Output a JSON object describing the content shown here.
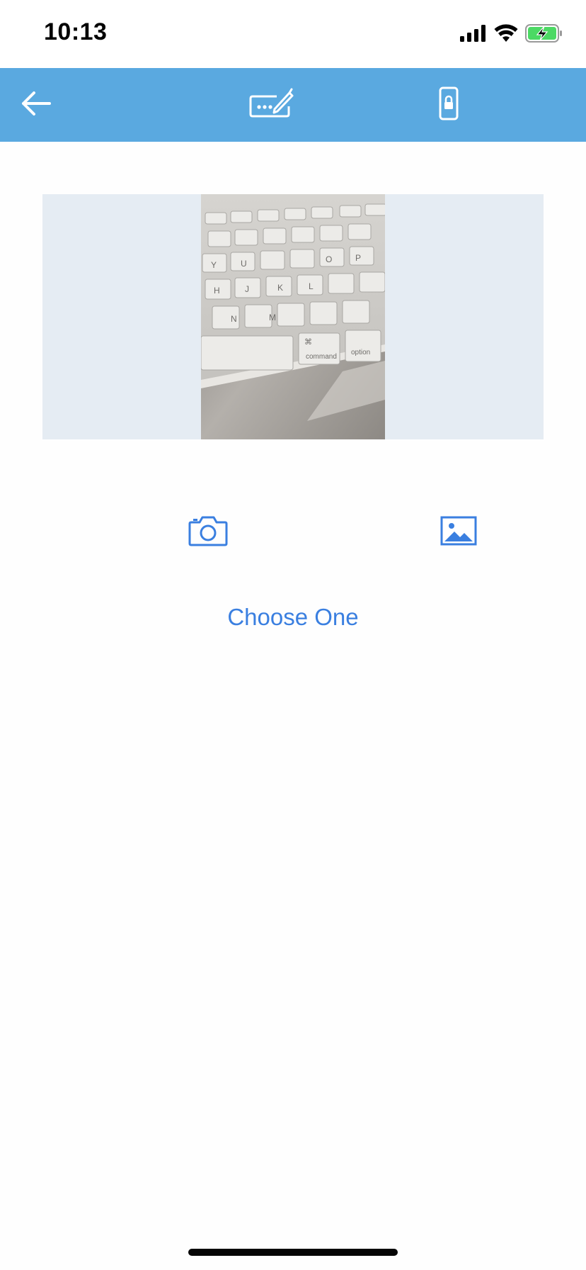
{
  "status_bar": {
    "time": "10:13",
    "icons": [
      "cellular-signal-icon",
      "wifi-icon",
      "battery-charging-icon"
    ]
  },
  "nav_bar": {
    "background_color": "#5aa9e0",
    "buttons": [
      {
        "icon": "back-arrow-icon"
      },
      {
        "icon": "signature-pad-icon"
      },
      {
        "icon": "phone-lock-icon"
      }
    ]
  },
  "preview": {
    "background_color": "#e5ecf3",
    "photo_subject": "keyboard-photo",
    "keyboard_keys": [
      "Y",
      "U",
      "H",
      "J",
      "K",
      "L",
      "N",
      "M",
      "P",
      "O",
      "command",
      "option",
      "⌘"
    ]
  },
  "actions": {
    "camera_icon": "camera-icon",
    "gallery_icon": "photo-gallery-icon",
    "accent_color": "#3a7fe0",
    "choose_label": "Choose One"
  }
}
